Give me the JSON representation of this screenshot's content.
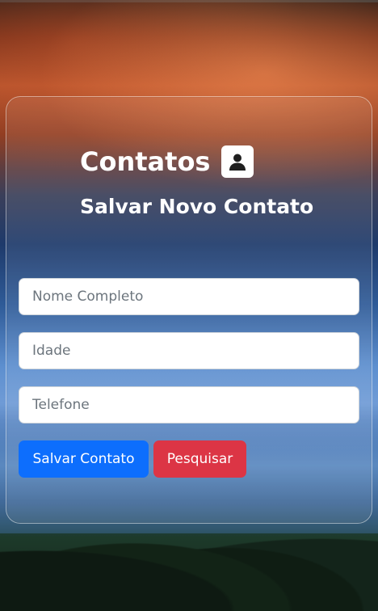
{
  "header": {
    "title": "Contatos",
    "subtitle": "Salvar Novo Contato"
  },
  "form": {
    "name_placeholder": "Nome Completo",
    "name_value": "",
    "age_placeholder": "Idade",
    "age_value": "",
    "phone_placeholder": "Telefone",
    "phone_value": ""
  },
  "actions": {
    "save_label": "Salvar Contato",
    "search_label": "Pesquisar"
  },
  "colors": {
    "primary": "#0d6efd",
    "danger": "#dc3545"
  },
  "icons": {
    "title_icon": "person-square-icon"
  }
}
